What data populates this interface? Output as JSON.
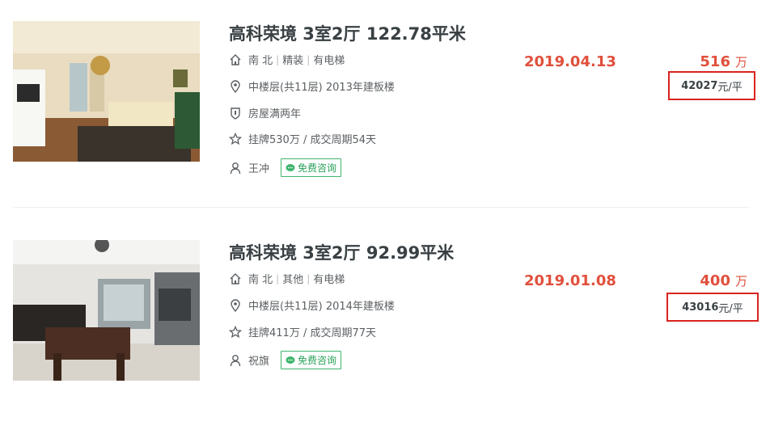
{
  "listings": [
    {
      "title": "高科荣境 3室2厅 122.78平米",
      "orientation": "南 北",
      "decoration": "精装",
      "elevator": "有电梯",
      "floor_info": "中楼层(共11层) 2013年建板楼",
      "tag": "房屋满两年",
      "listing_info": "挂牌530万 / 成交周期54天",
      "agent": "王冲",
      "consult_label": "免费咨询",
      "deal_date": "2019.04.13",
      "total_price": "516",
      "total_unit": "万",
      "unit_price_value": "42027",
      "unit_price_suffix": "元/平"
    },
    {
      "title": "高科荣境 3室2厅 92.99平米",
      "orientation": "南 北",
      "decoration": "其他",
      "elevator": "有电梯",
      "floor_info": "中楼层(共11层) 2014年建板楼",
      "listing_info": "挂牌411万 / 成交周期77天",
      "agent": "祝旗",
      "consult_label": "免费咨询",
      "deal_date": "2019.01.08",
      "total_price": "400",
      "total_unit": "万",
      "unit_price_value": "43016",
      "unit_price_suffix": "元/平"
    }
  ],
  "colors": {
    "price_red": "#e0503c",
    "highlight_border": "#d9231f",
    "consult_green": "#3fb46e"
  },
  "icons": {
    "house": "house-icon",
    "location": "location-pin-icon",
    "shield": "shield-icon",
    "star": "star-icon",
    "user": "user-icon",
    "chat": "chat-bubble-icon"
  }
}
